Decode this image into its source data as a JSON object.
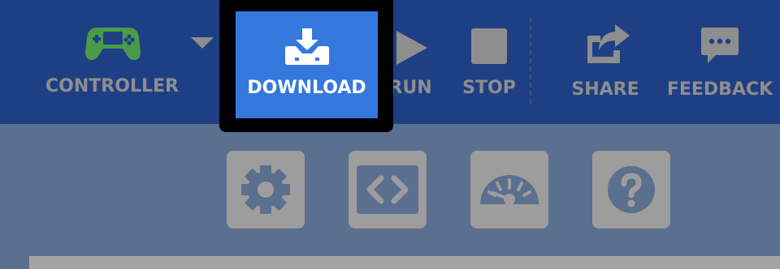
{
  "toolbar": {
    "controller": {
      "label": "CONTROLLER",
      "icon": "gamepad-icon",
      "color": "#4a9a4a"
    },
    "dropdown": {
      "icon": "chevron-down-icon"
    },
    "download": {
      "label": "DOWNLOAD",
      "icon": "download-icon",
      "color": "#3578dd"
    },
    "run": {
      "label": "RUN",
      "icon": "play-icon"
    },
    "stop": {
      "label": "STOP",
      "icon": "stop-icon"
    },
    "share": {
      "label": "SHARE",
      "icon": "share-icon"
    },
    "feedback": {
      "label": "FEEDBACK",
      "icon": "chat-icon"
    }
  },
  "secondary": [
    {
      "name": "settings-button",
      "icon": "gear-icon"
    },
    {
      "name": "code-button",
      "icon": "code-icon"
    },
    {
      "name": "dashboard-button",
      "icon": "gauge-icon"
    },
    {
      "name": "help-button",
      "icon": "help-icon"
    }
  ]
}
